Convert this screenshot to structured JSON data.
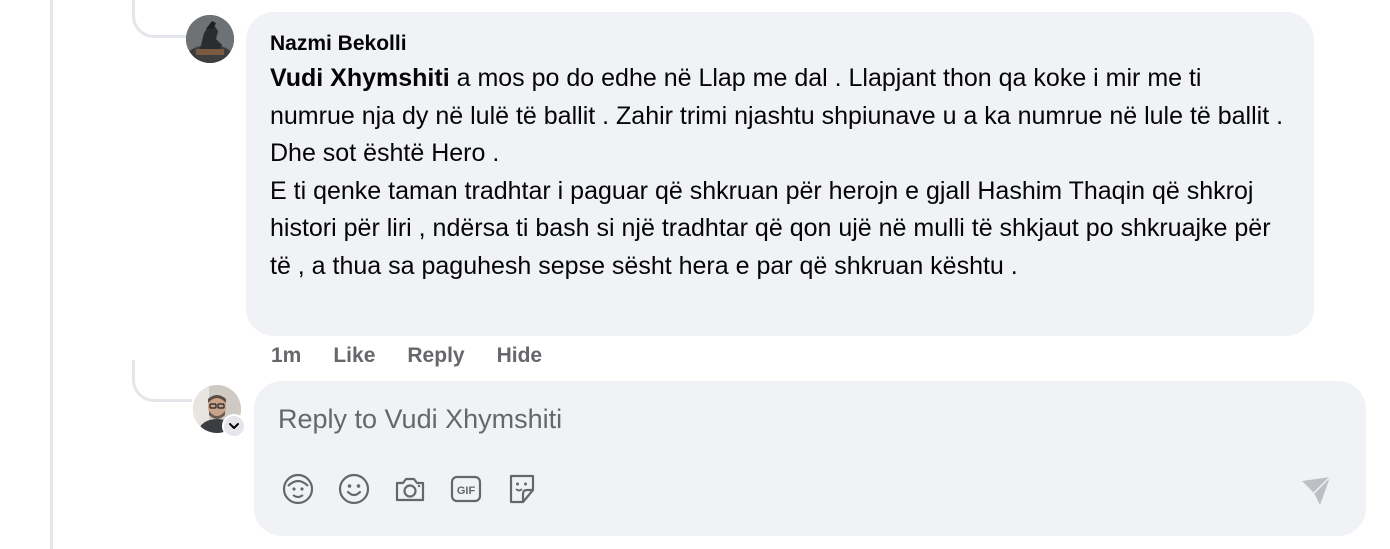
{
  "comment": {
    "author": "Nazmi Bekolli",
    "mention": "Vudi Xhymshiti",
    "text": " a mos po do edhe në Llap me dal . Llapjant thon qa koke i mir me ti numrue nja dy në lulë të ballit . Zahir trimi njashtu shpiunave u a ka numrue në lule të ballit . Dhe sot është Hero .\nE ti qenke taman tradhtar i paguar që shkruan për herojn e gjall Hashim Thaqin që shkroj histori për liri , ndërsa ti bash si një tradhtar që qon ujë në mulli të shkjaut po shkruajke për të , a thua sa paguhesh sepse sësht hera e par që shkruan kështu .",
    "timestamp": "1m",
    "like_label": "Like",
    "reply_label": "Reply",
    "hide_label": "Hide"
  },
  "composer": {
    "placeholder": "Reply to Vudi Xhymshiti",
    "value": ""
  },
  "icons": {
    "avatar_sticker": "avatar-sticker-icon",
    "emoji": "emoji-icon",
    "camera": "camera-icon",
    "gif": "gif-icon",
    "sticker": "sticker-icon",
    "send": "send-icon",
    "chevron": "chevron-down-icon"
  },
  "colors": {
    "bubble_bg": "#f0f2f5",
    "secondary_text": "#65676b",
    "primary_text": "#050505",
    "thread_line": "#e4e6eb"
  }
}
